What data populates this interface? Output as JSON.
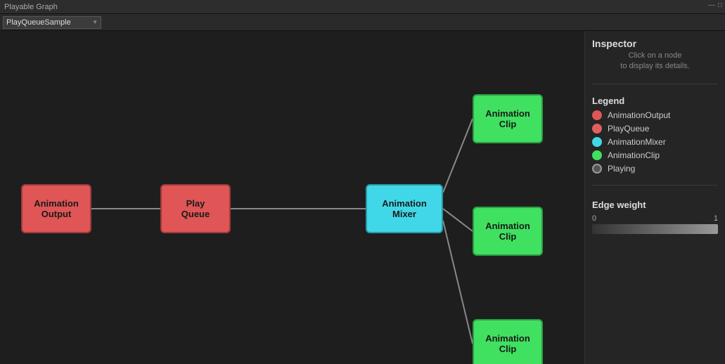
{
  "titleBar": {
    "title": "Playable Graph",
    "minButton": "—",
    "maxButton": "□"
  },
  "toolbar": {
    "dropdown": {
      "value": "PlayQueueSample",
      "options": [
        "PlayQueueSample"
      ]
    }
  },
  "nodes": {
    "animationOutput": {
      "label": "Animation\nOutput",
      "labelLine1": "Animation",
      "labelLine2": "Output"
    },
    "playQueue": {
      "label": "Play\nQueue",
      "labelLine1": "Play",
      "labelLine2": "Queue"
    },
    "animationMixer": {
      "label": "Animation\nMixer",
      "labelLine1": "Animation",
      "labelLine2": "Mixer"
    },
    "clipTop": {
      "label": "Animation\nClip",
      "labelLine1": "Animation",
      "labelLine2": "Clip"
    },
    "clipMiddle": {
      "label": "Animation\nClip",
      "labelLine1": "Animation",
      "labelLine2": "Clip"
    },
    "clipBottom": {
      "label": "Animation\nClip",
      "labelLine1": "Animation",
      "labelLine2": "Clip"
    }
  },
  "inspector": {
    "title": "Inspector",
    "hint": "Click on a node\nto display its details.",
    "hintLine1": "Click on a node",
    "hintLine2": "to display its details."
  },
  "legend": {
    "title": "Legend",
    "items": [
      {
        "label": "AnimationOutput",
        "color": "anim-output"
      },
      {
        "label": "PlayQueue",
        "color": "play-queue"
      },
      {
        "label": "AnimationMixer",
        "color": "anim-mixer"
      },
      {
        "label": "AnimationClip",
        "color": "anim-clip"
      },
      {
        "label": "Playing",
        "color": "playing"
      }
    ]
  },
  "edgeWeight": {
    "title": "Edge weight",
    "min": "0",
    "max": "1"
  }
}
